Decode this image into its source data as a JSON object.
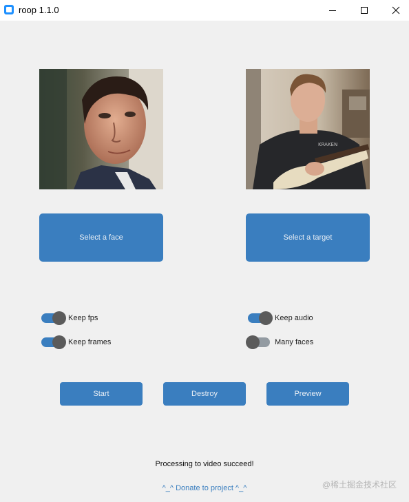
{
  "window": {
    "title": "roop 1.1.0",
    "controls": [
      "minimize-icon",
      "maximize-icon",
      "close-icon"
    ]
  },
  "source_image": {
    "description_icon": "face-portrait-image"
  },
  "target_image": {
    "description_icon": "guitar-player-image"
  },
  "buttons": {
    "select_face": "Select a face",
    "select_target": "Select a target",
    "start": "Start",
    "destroy": "Destroy",
    "preview": "Preview"
  },
  "switches": {
    "keep_fps": {
      "label": "Keep fps",
      "on": true
    },
    "keep_frames": {
      "label": "Keep frames",
      "on": true
    },
    "keep_audio": {
      "label": "Keep audio",
      "on": true
    },
    "many_faces": {
      "label": "Many faces",
      "on": false
    }
  },
  "status_text": "Processing to video succeed!",
  "donate_link": "^_^ Donate to project ^_^",
  "watermark": "@稀土掘金技术社区",
  "colors": {
    "accent": "#3a7ebf",
    "background": "#f0f0f0",
    "switch_off": "#939ba2",
    "knob": "#5b5b5b"
  }
}
